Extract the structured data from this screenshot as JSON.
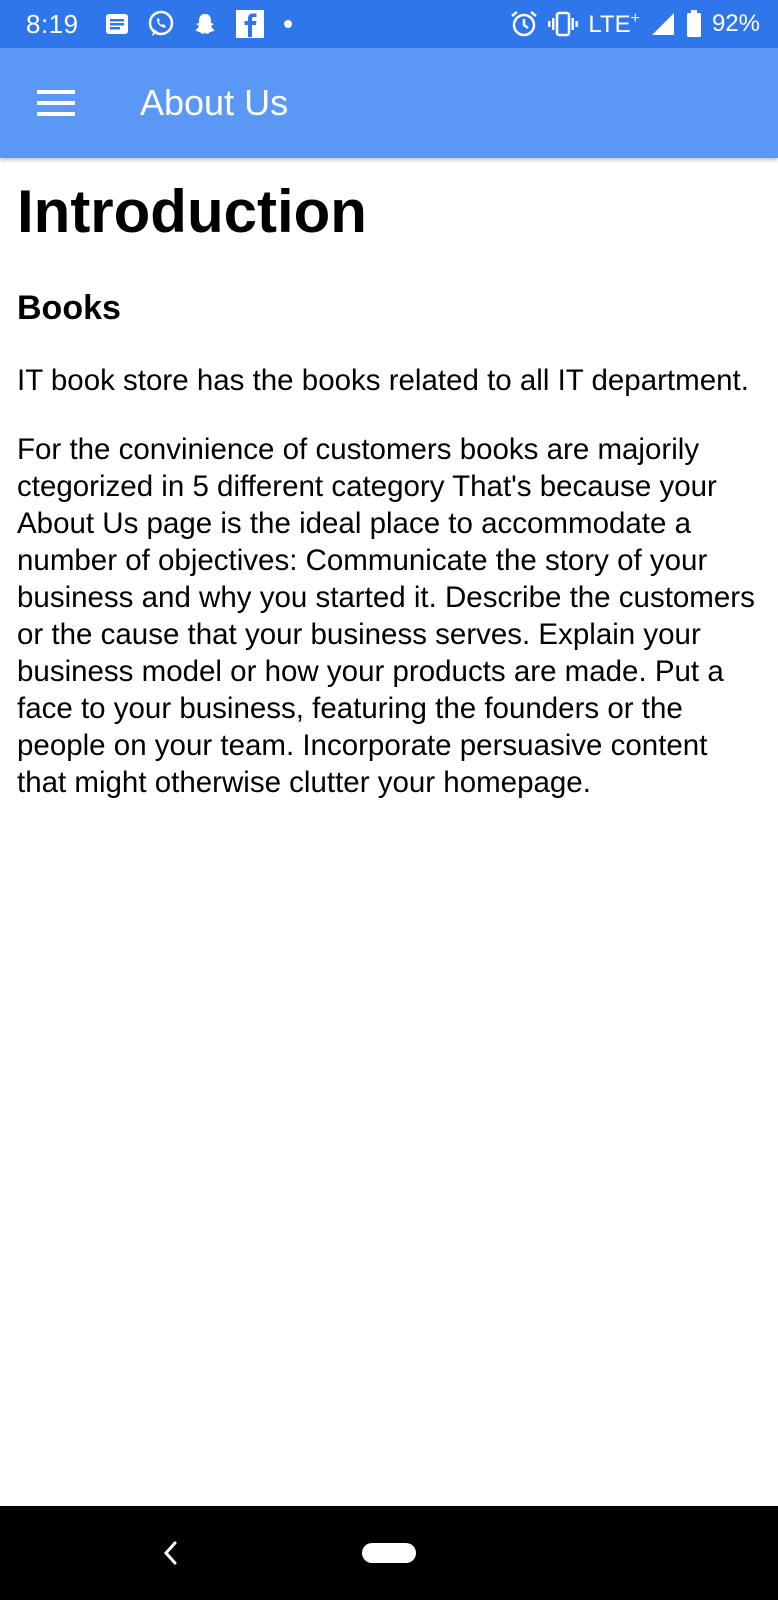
{
  "status_bar": {
    "time": "8:19",
    "network": "LTE",
    "network_plus": "+",
    "battery": "92%",
    "left_icons": [
      "message-icon",
      "whatsapp-icon",
      "snapchat-icon",
      "facebook-icon",
      "dot-icon"
    ],
    "right_icons": [
      "alarm-icon",
      "vibrate-icon",
      "signal-icon",
      "battery-icon"
    ]
  },
  "app_bar": {
    "title": "About Us",
    "menu_icon": "hamburger-menu-icon"
  },
  "content": {
    "heading": "Introduction",
    "section_title": "Books",
    "paragraphs": [
      "IT book store has the books related to all IT department.",
      "For the convinience of customers books are majorily ctegorized in 5 different category That's because your About Us page is the ideal place to accommodate a number of objectives: Communicate the story of your business and why you started it. Describe the customers or the cause that your business serves. Explain your business model or how your products are made. Put a face to your business, featuring the founders or the people on your team. Incorporate persuasive content that might otherwise clutter your homepage."
    ]
  },
  "nav_bar": {
    "back_icon": "back-icon",
    "home_icon": "home-pill-icon"
  },
  "colors": {
    "status_bar": "#2f76ea",
    "app_bar": "#5b97f5",
    "nav_bar": "#000000",
    "background": "#ffffff"
  }
}
